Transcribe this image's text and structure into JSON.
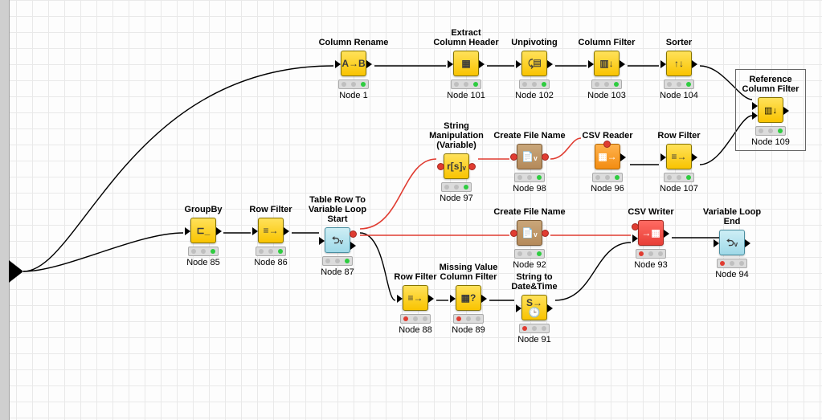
{
  "nodes": {
    "n1": {
      "title": "Column Rename",
      "id": "Node 1"
    },
    "n101": {
      "title": "Extract\nColumn Header",
      "id": "Node 101"
    },
    "n102": {
      "title": "Unpivoting",
      "id": "Node 102"
    },
    "n103": {
      "title": "Column Filter",
      "id": "Node 103"
    },
    "n104": {
      "title": "Sorter",
      "id": "Node 104"
    },
    "n109": {
      "title": "Reference\nColumn Filter",
      "id": "Node 109"
    },
    "n97": {
      "title": "String Manipulation\n(Variable)",
      "id": "Node 97"
    },
    "n98": {
      "title": "Create File Name",
      "id": "Node 98"
    },
    "n96": {
      "title": "CSV Reader",
      "id": "Node 96"
    },
    "n107": {
      "title": "Row Filter",
      "id": "Node 107"
    },
    "n85": {
      "title": "GroupBy",
      "id": "Node 85"
    },
    "n86": {
      "title": "Row Filter",
      "id": "Node 86"
    },
    "n87": {
      "title": "Table Row To\nVariable Loop Start",
      "id": "Node 87"
    },
    "n92": {
      "title": "Create File Name",
      "id": "Node 92"
    },
    "n93": {
      "title": "CSV Writer",
      "id": "Node 93"
    },
    "n94": {
      "title": "Variable Loop End",
      "id": "Node 94"
    },
    "n88": {
      "title": "Row Filter",
      "id": "Node 88"
    },
    "n89": {
      "title": "Missing Value\nColumn Filter",
      "id": "Node 89"
    },
    "n91": {
      "title": "String to Date&Time",
      "id": "Node 91"
    }
  },
  "status_legend": {
    "green": "executed",
    "red": "not-configured/error",
    "grey": "idle"
  },
  "colors": {
    "data_wire": "#000000",
    "variable_wire": "#e03c31",
    "node_yellow": "#f9c400",
    "node_brown": "#b58a5a",
    "node_orange": "#f38d12",
    "node_red": "#e83f37",
    "node_cyan": "#9fd9e8"
  }
}
